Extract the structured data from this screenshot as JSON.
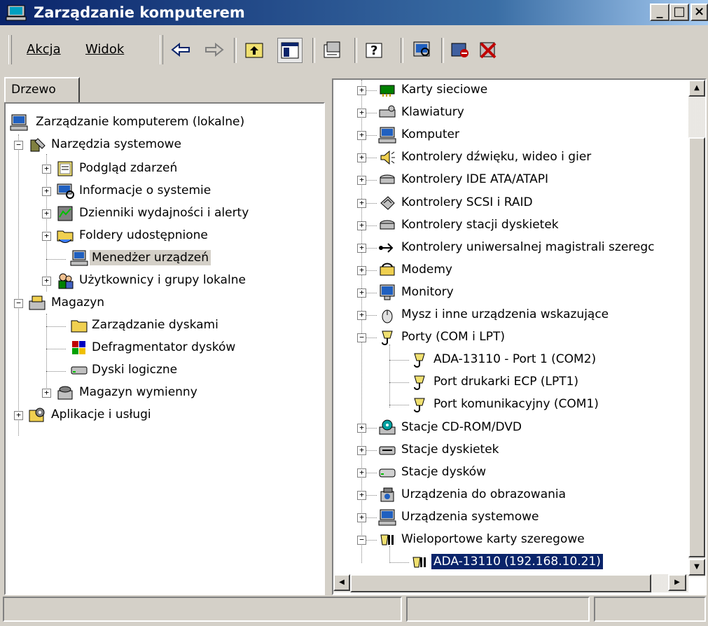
{
  "window": {
    "title": "Zarządzanie komputerem"
  },
  "caption_buttons": {
    "minimize": "_",
    "maximize": "□",
    "close": "×"
  },
  "menu": {
    "action": "Akcja",
    "view": "Widok"
  },
  "tabs": {
    "tree": "Drzewo"
  },
  "left_tree": [
    "Zarządzanie komputerem (lokalne)",
    "Narzędzia systemowe",
    "Podgląd zdarzeń",
    "Informacje o systemie",
    "Dzienniki wydajności i alerty",
    "Foldery udostępnione",
    "Menedżer urządzeń",
    "Użytkownicy i grupy lokalne",
    "Magazyn",
    "Zarządzanie dyskami",
    "Defragmentator dysków",
    "Dyski logiczne",
    "Magazyn wymienny",
    "Aplikacje i usługi"
  ],
  "right_tree": [
    "Karty sieciowe",
    "Klawiatury",
    "Komputer",
    "Kontrolery dźwięku, wideo i gier",
    "Kontrolery IDE ATA/ATAPI",
    "Kontrolery SCSI i RAID",
    "Kontrolery stacji dyskietek",
    "Kontrolery uniwersalnej magistrali szeregc",
    "Modemy",
    "Monitory",
    "Mysz i inne urządzenia wskazujące",
    "Porty (COM i LPT)",
    "ADA-13110 - Port 1 (COM2)",
    "Port drukarki ECP (LPT1)",
    "Port komunikacyjny (COM1)",
    "Stacje CD-ROM/DVD",
    "Stacje dyskietek",
    "Stacje dysków",
    "Urządzenia do obrazowania",
    "Urządzenia systemowe",
    "Wieloportowe karty szeregowe",
    "ADA-13110 (192.168.10.21)"
  ],
  "colors": {
    "titlebar": "#0a246a",
    "selection": "#0a246a",
    "face": "#d4d0c8"
  }
}
